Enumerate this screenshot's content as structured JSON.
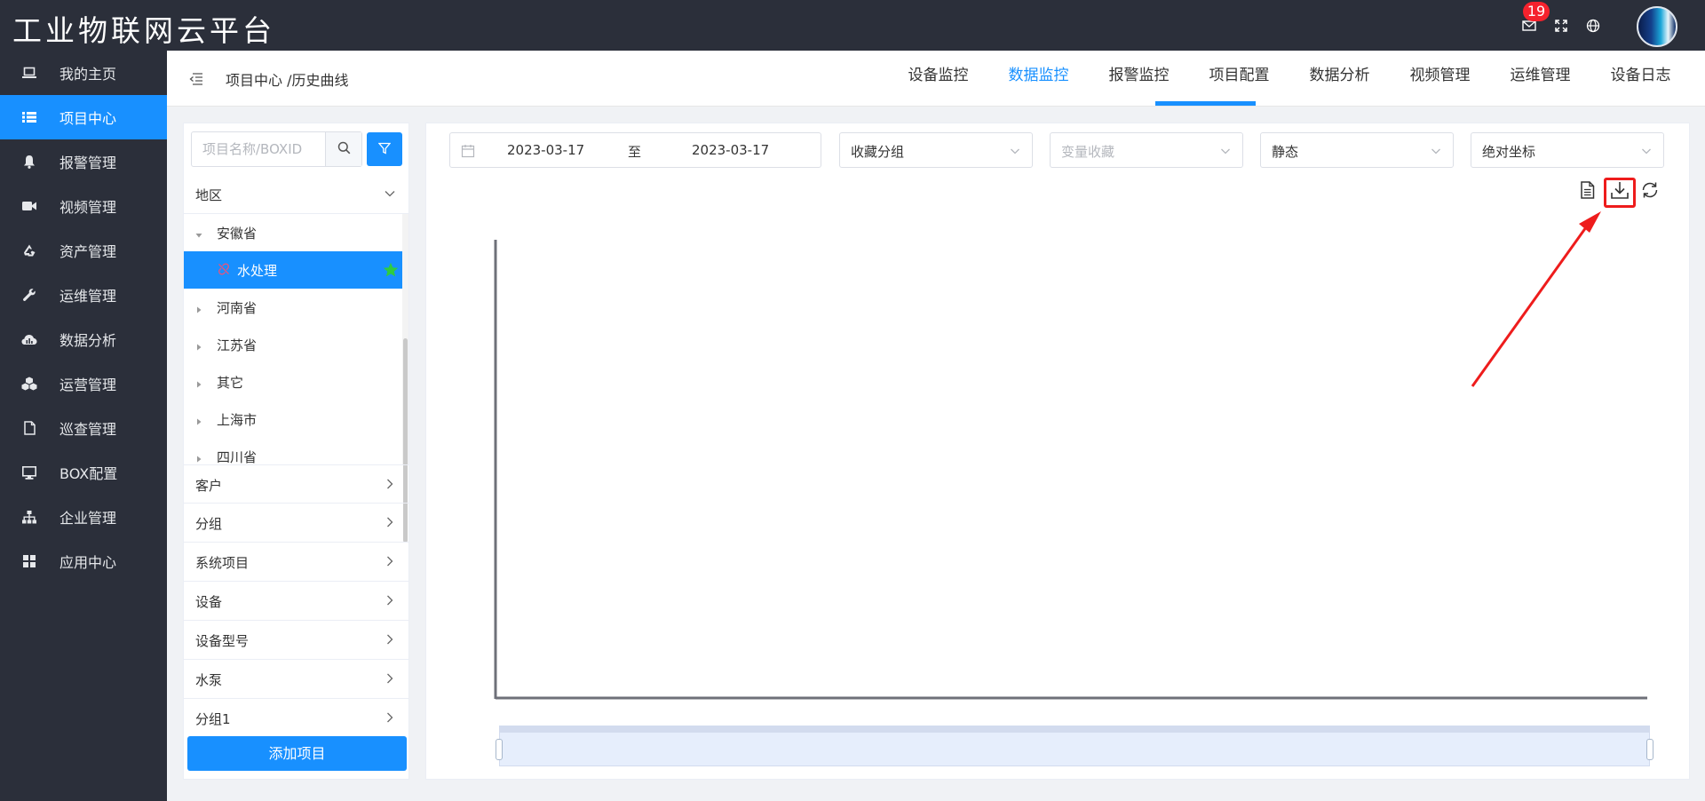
{
  "app": {
    "title": "工业物联网云平台",
    "notification_count": "19",
    "icons": [
      "mail-icon",
      "fullscreen-icon",
      "globe-icon"
    ]
  },
  "sidebar": {
    "items": [
      {
        "label": "我的主页",
        "icon": "laptop-icon",
        "active": false
      },
      {
        "label": "项目中心",
        "icon": "list-icon",
        "active": true
      },
      {
        "label": "报警管理",
        "icon": "bell-icon",
        "active": false
      },
      {
        "label": "视频管理",
        "icon": "video-camera-icon",
        "active": false
      },
      {
        "label": "资产管理",
        "icon": "recycle-icon",
        "active": false
      },
      {
        "label": "运维管理",
        "icon": "wrench-icon",
        "active": false
      },
      {
        "label": "数据分析",
        "icon": "cloud-chart-icon",
        "active": false
      },
      {
        "label": "运营管理",
        "icon": "cubes-icon",
        "active": false
      },
      {
        "label": "巡查管理",
        "icon": "file-icon",
        "active": false
      },
      {
        "label": "BOX配置",
        "icon": "monitor-icon",
        "active": false
      },
      {
        "label": "企业管理",
        "icon": "org-chart-icon",
        "active": false
      },
      {
        "label": "应用中心",
        "icon": "grid-icon",
        "active": false
      }
    ]
  },
  "header": {
    "breadcrumb": "项目中心 /历史曲线",
    "tabs": [
      {
        "label": "设备监控",
        "active": false
      },
      {
        "label": "数据监控",
        "active": true
      },
      {
        "label": "报警监控",
        "active": false
      },
      {
        "label": "项目配置",
        "active": false
      },
      {
        "label": "数据分析",
        "active": false
      },
      {
        "label": "视频管理",
        "active": false
      },
      {
        "label": "运维管理",
        "active": false
      },
      {
        "label": "设备日志",
        "active": false
      }
    ]
  },
  "tree_panel": {
    "search": {
      "placeholder": "项目名称/BOXID",
      "value": ""
    },
    "region_group": "地区",
    "tree": [
      {
        "label": "安徽省",
        "expanded": true,
        "selected": false,
        "level": 0
      },
      {
        "label": "水处理",
        "expanded": false,
        "selected": true,
        "level": 1,
        "favorite": true
      },
      {
        "label": "河南省",
        "expanded": false,
        "selected": false,
        "level": 0
      },
      {
        "label": "江苏省",
        "expanded": false,
        "selected": false,
        "level": 0
      },
      {
        "label": "其它",
        "expanded": false,
        "selected": false,
        "level": 0
      },
      {
        "label": "上海市",
        "expanded": false,
        "selected": false,
        "level": 0
      },
      {
        "label": "四川省",
        "expanded": false,
        "selected": false,
        "level": 0
      }
    ],
    "groups": [
      "客户",
      "分组",
      "系统项目",
      "设备",
      "设备型号",
      "水泵",
      "分组1"
    ],
    "add_button": "添加项目"
  },
  "toolbar": {
    "date_start": "2023-03-17",
    "date_separator": "至",
    "date_end": "2023-03-17",
    "selects": [
      {
        "value": "收藏分组",
        "placeholder": false
      },
      {
        "value": "变量收藏",
        "placeholder": true
      },
      {
        "value": "静态",
        "placeholder": false
      },
      {
        "value": "绝对坐标",
        "placeholder": false
      }
    ],
    "tools": [
      "document-icon",
      "download-icon",
      "refresh-icon"
    ],
    "highlighted_tool": "download-icon"
  },
  "chart_data": {
    "type": "line",
    "series": [],
    "has_data_zoom": true,
    "data_zoom_range": [
      0,
      100
    ]
  },
  "colors": {
    "primary": "#1890ff",
    "sidebar_bg": "#2b2f3a",
    "annotation_red": "#ee1c1c",
    "favorite_green": "#2ecc40"
  }
}
